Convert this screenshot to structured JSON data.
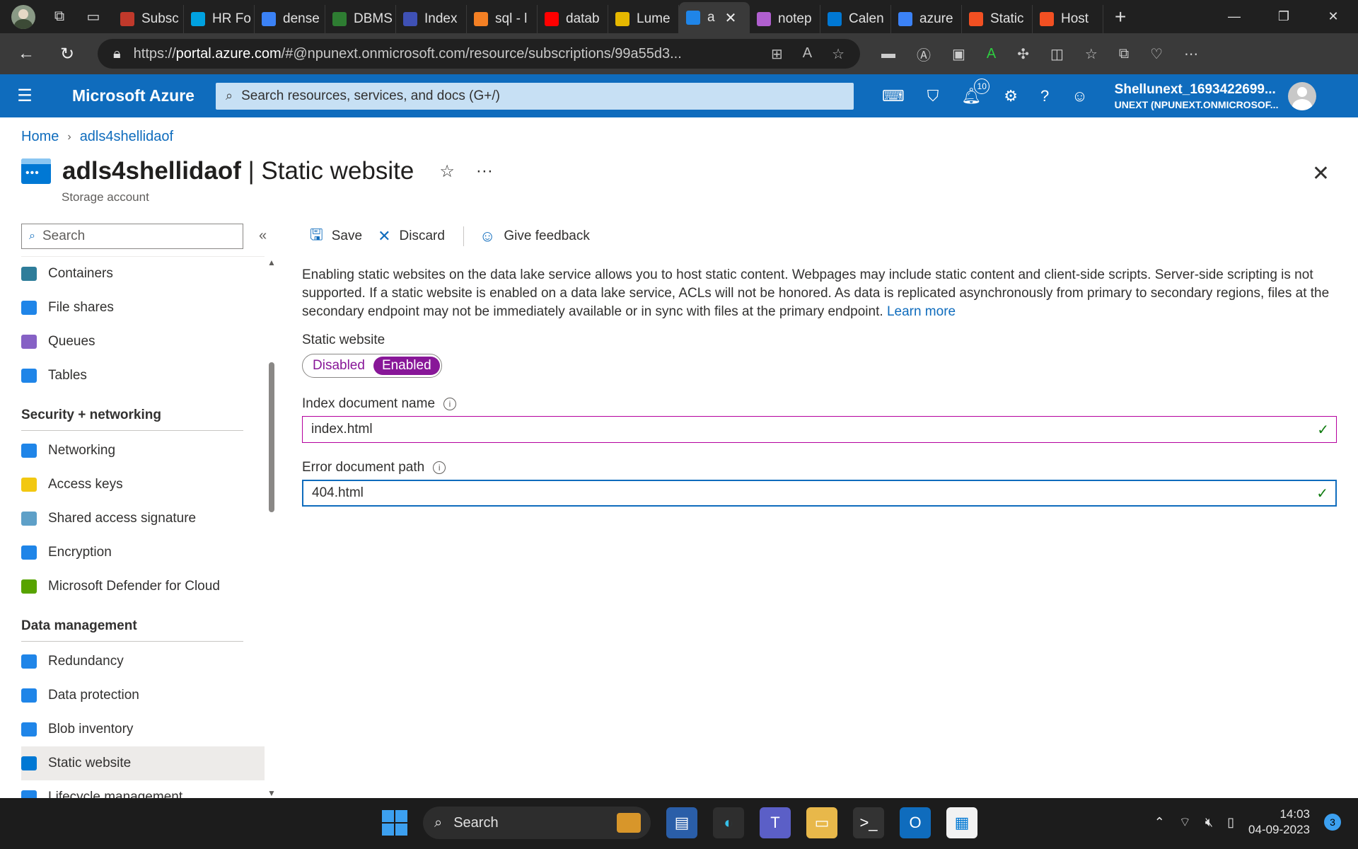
{
  "browser": {
    "tabs": [
      {
        "label": "Subsc",
        "color": "#c0392b"
      },
      {
        "label": "HR Fo",
        "color": "#00a1e0"
      },
      {
        "label": "dense",
        "color": "#3b82f6"
      },
      {
        "label": "DBMS",
        "color": "#2e7d32"
      },
      {
        "label": "Index",
        "color": "#3f51b5"
      },
      {
        "label": "sql - l",
        "color": "#f48024"
      },
      {
        "label": "datab",
        "color": "#ff0000"
      },
      {
        "label": "Lume",
        "color": "#e6b800"
      },
      {
        "label": "a",
        "color": "#1f85e8",
        "active": true
      },
      {
        "label": "notep",
        "color": "#b05fcf"
      },
      {
        "label": "Calen",
        "color": "#0078d4"
      },
      {
        "label": "azure",
        "color": "#3b82f6"
      },
      {
        "label": "Static",
        "color": "#f25022"
      },
      {
        "label": "Host",
        "color": "#f25022"
      }
    ],
    "url_scheme": "https://",
    "url_host": "portal.azure.com",
    "url_rest": "/#@npunext.onmicrosoft.com/resource/subscriptions/99a55d3..."
  },
  "azure": {
    "brand": "Microsoft Azure",
    "search_placeholder": "Search resources, services, and docs (G+/)",
    "notification_count": "10",
    "user_name": "Shellunext_1693422699...",
    "user_tenant": "UNEXT (NPUNEXT.ONMICROSOF..."
  },
  "breadcrumb": {
    "home": "Home",
    "resource": "adls4shellidaof"
  },
  "page": {
    "resource_name": "adls4shellidaof",
    "blade_name": "| Static website",
    "subtitle": "Storage account"
  },
  "sidebar": {
    "search_placeholder": "Search",
    "items_top": [
      {
        "label": "Containers",
        "color": "#2e7d9a"
      },
      {
        "label": "File shares",
        "color": "#1f85e8"
      },
      {
        "label": "Queues",
        "color": "#8661c5"
      },
      {
        "label": "Tables",
        "color": "#1f85e8"
      }
    ],
    "section_security": "Security + networking",
    "items_security": [
      {
        "label": "Networking",
        "color": "#1f85e8"
      },
      {
        "label": "Access keys",
        "color": "#f2c811"
      },
      {
        "label": "Shared access signature",
        "color": "#5ea0c8"
      },
      {
        "label": "Encryption",
        "color": "#1f85e8"
      },
      {
        "label": "Microsoft Defender for Cloud",
        "color": "#57a300"
      }
    ],
    "section_data": "Data management",
    "items_data": [
      {
        "label": "Redundancy",
        "color": "#1f85e8"
      },
      {
        "label": "Data protection",
        "color": "#1f85e8"
      },
      {
        "label": "Blob inventory",
        "color": "#1f85e8"
      },
      {
        "label": "Static website",
        "color": "#0078d4",
        "selected": true
      },
      {
        "label": "Lifecycle management",
        "color": "#1f85e8"
      }
    ]
  },
  "toolbar": {
    "save": "Save",
    "discard": "Discard",
    "feedback": "Give feedback"
  },
  "content": {
    "description": "Enabling static websites on the data lake service allows you to host static content. Webpages may include static content and client-side scripts. Server-side scripting is not supported. If a static website is enabled on a data lake service, ACLs will not be honored. As data is replicated asynchronously from primary to secondary regions, files at the secondary endpoint may not be immediately available or in sync with files at the primary endpoint.",
    "learn_more": "Learn more",
    "static_website_label": "Static website",
    "toggle_disabled": "Disabled",
    "toggle_enabled": "Enabled",
    "index_label": "Index document name",
    "index_value": "index.html",
    "error_label": "Error document path",
    "error_value": "404.html"
  },
  "taskbar": {
    "search_label": "Search",
    "time": "14:03",
    "date": "04-09-2023",
    "notification_badge": "3"
  }
}
